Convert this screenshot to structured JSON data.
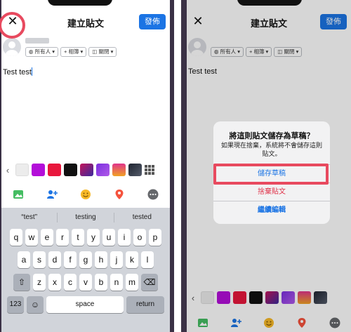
{
  "left": {
    "title": "建立貼文",
    "publish_label": "發佈",
    "close_glyph": "✕",
    "chips": [
      "所有人 ▾",
      "+ 相簿 ▾",
      "關閉 ▾"
    ],
    "post_text": "Test test",
    "suggestions": [
      "“test”",
      "testing",
      "tested"
    ],
    "keyboard": {
      "row1": [
        "q",
        "w",
        "e",
        "r",
        "t",
        "y",
        "u",
        "i",
        "o",
        "p"
      ],
      "row2": [
        "a",
        "s",
        "d",
        "f",
        "g",
        "h",
        "j",
        "k",
        "l"
      ],
      "row3": [
        "z",
        "x",
        "c",
        "v",
        "b",
        "n",
        "m"
      ],
      "num_label": "123",
      "space_label": "space",
      "return_label": "return"
    }
  },
  "right": {
    "title": "建立貼文",
    "publish_label": "發佈",
    "close_glyph": "✕",
    "chips": [
      "所有人 ▾",
      "+ 相簿 ▾",
      "關閉 ▾"
    ],
    "post_text": "Test test",
    "dialog": {
      "title": "將這則貼文儲存為草稿？",
      "message": "如果現在捨棄，系統將不會儲存這則貼文。",
      "save_draft": "儲存草稿",
      "discard": "捨棄貼文",
      "continue_edit": "繼續編輯"
    }
  },
  "colors": {
    "accent": "#1b74e4",
    "highlight_ring": "#e84a5f",
    "discard": "#e0334a",
    "swatches": [
      "#ececec",
      "#b30fd9",
      "#e8173c",
      "#111111",
      "#7b2fb0",
      "#9b3fe0",
      "#f08a24",
      "#2a2f3a"
    ]
  },
  "icons": [
    "close-icon",
    "globe-icon",
    "instagram-icon",
    "grid-icon",
    "photo-icon",
    "tag-people-icon",
    "emoji-icon",
    "location-icon",
    "more-icon",
    "backspace-icon",
    "shift-icon",
    "emoji-keyboard-icon"
  ]
}
